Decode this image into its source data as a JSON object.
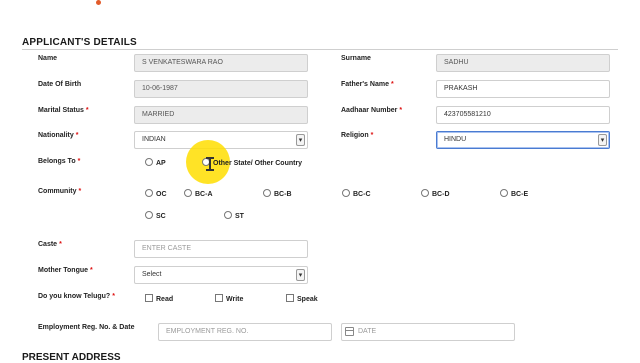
{
  "section_title": "APPLICANT'S DETAILS",
  "next_section_title": "PRESENT ADDRESS",
  "fields": {
    "name": {
      "label": "Name",
      "value": "S VENKATESWARA RAO"
    },
    "surname": {
      "label": "Surname",
      "value": "SADHU"
    },
    "dob": {
      "label": "Date Of Birth",
      "value": "10-06-1987"
    },
    "father": {
      "label": "Father's Name",
      "value": "PRAKASH"
    },
    "marital": {
      "label": "Marital Status",
      "value": "MARRIED"
    },
    "aadhaar": {
      "label": "Aadhaar Number",
      "value": "423705581210"
    },
    "nationality": {
      "label": "Nationality",
      "value": "INDIAN"
    },
    "religion": {
      "label": "Religion",
      "value": "HINDU"
    },
    "caste": {
      "label": "Caste",
      "placeholder": "ENTER CASTE"
    },
    "mother_tongue": {
      "label": "Mother Tongue",
      "value": "Select"
    },
    "employment": {
      "label": "Employment Reg. No. & Date",
      "placeholder": "EMPLOYMENT REG. NO.",
      "date_placeholder": "DATE"
    }
  },
  "belongs_to": {
    "label": "Belongs To",
    "options": [
      "AP",
      "Other State/ Other Country"
    ]
  },
  "community": {
    "label": "Community",
    "options": [
      "OC",
      "BC-A",
      "BC-B",
      "BC-C",
      "BC-D",
      "BC-E",
      "SC",
      "ST"
    ]
  },
  "telugu": {
    "label": "Do you know Telugu?",
    "options": [
      "Read",
      "Write",
      "Speak"
    ]
  },
  "required_mark": "*",
  "dropdown_glyph": "▾",
  "colors": {
    "required": "#dd1111",
    "focus_border": "#4a7bd1",
    "highlight": "#ffde00"
  }
}
